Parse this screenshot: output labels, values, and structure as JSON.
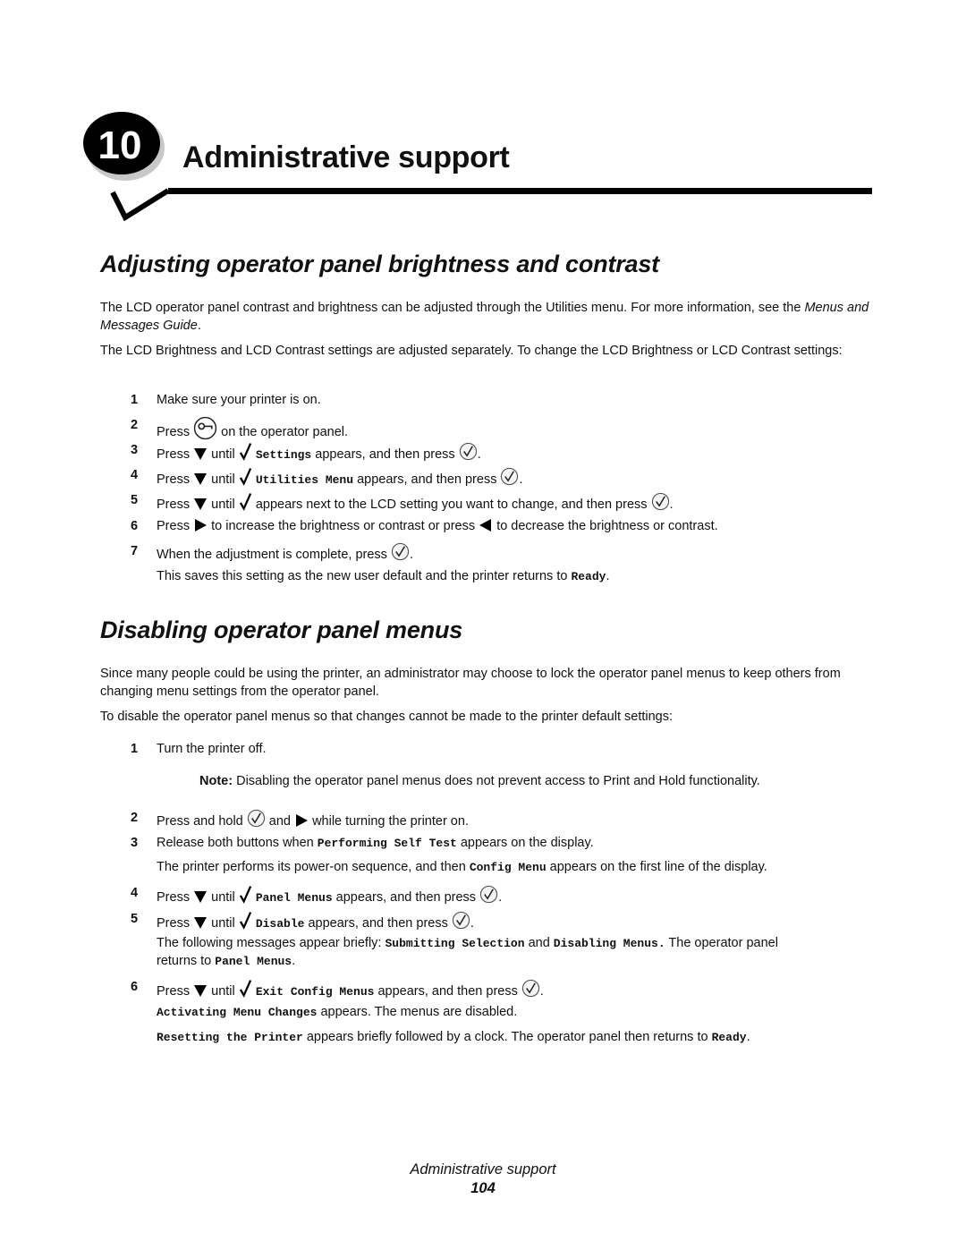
{
  "chapter": {
    "number": "10",
    "title": "Administrative support"
  },
  "section1": {
    "heading": "Adjusting operator panel brightness and contrast",
    "para1_a": "The LCD operator panel contrast and brightness can be adjusted through the Utilities menu. For more information, see the",
    "para1_b": "Menus and Messages Guide",
    "para1_c": ".",
    "para2": "The LCD Brightness and LCD Contrast settings are adjusted separately. To change the LCD Brightness or LCD Contrast settings:",
    "steps": [
      {
        "num": "1",
        "t1": "Make sure your printer is on."
      },
      {
        "num": "2",
        "t1": "Press",
        "t2": "on the operator panel."
      },
      {
        "num": "3",
        "t1": "Press",
        "t2": "until",
        "code": "Settings",
        "t3": "appears, and then press",
        "t4": "."
      },
      {
        "num": "4",
        "t1": "Press",
        "t2": "until",
        "code": "Utilities Menu",
        "t3": "appears, and then press",
        "t4": "."
      },
      {
        "num": "5",
        "t1": "Press",
        "t2": "until",
        "t3": "appears next to the LCD setting you want to change, and then press",
        "t4": "."
      },
      {
        "num": "6",
        "t1": "Press",
        "t2": "to increase the brightness or contrast or press",
        "t3": "to decrease the brightness or contrast."
      },
      {
        "num": "7",
        "t1": "When the adjustment is complete, press",
        "t2": "."
      }
    ],
    "after7_a": "This saves this setting as the new user default and the printer returns to",
    "after7_code": "Ready",
    "after7_b": "."
  },
  "section2": {
    "heading": "Disabling operator panel menus",
    "para1": "Since many people could be using the printer, an administrator may choose to lock the operator panel menus to keep others from changing menu settings from the operator panel.",
    "para2": "To disable the operator panel menus so that changes cannot be made to the printer default settings:",
    "steps": [
      {
        "num": "1",
        "t1": "Turn the printer off."
      },
      {
        "num": "2",
        "t1": "Press and hold",
        "t2": "and",
        "t3": "while turning the printer on."
      },
      {
        "num": "3",
        "t1": "Release both buttons when",
        "code": "Performing Self Test",
        "t2": "appears on the display."
      },
      {
        "num": "4",
        "t1": "Press",
        "t2": "until",
        "code": "Panel Menus",
        "t3": "appears, and then press",
        "t4": "."
      },
      {
        "num": "5",
        "t1": "Press",
        "t2": "until",
        "code": "Disable",
        "t3": "appears, and then press",
        "t4": "."
      },
      {
        "num": "6",
        "t1": "Press",
        "t2": "until",
        "code": "Exit Config Menus",
        "t3": "appears, and then press",
        "t4": "."
      }
    ],
    "note_label": "Note:",
    "note_text": "Disabling the operator panel menus does not prevent access to Print and Hold functionality.",
    "after3_a": "The printer performs its power-on sequence, and then",
    "after3_code": "Config Menu",
    "after3_b": "appears on the first line of the display.",
    "after5_a": "The following messages appear briefly:",
    "after5_code1": "Submitting Selection",
    "after5_b": "and",
    "after5_code2": "Disabling Menus.",
    "after5_c": "The operator panel",
    "after5_d": "returns to",
    "after5_code3": "Panel Menus",
    "after5_e": ".",
    "after6a_code": "Activating Menu Changes",
    "after6a_text": "appears. The menus are disabled.",
    "after6b_code": "Resetting the Printer",
    "after6b_text": "appears briefly followed by a clock. The operator panel then returns to",
    "after6b_code2": "Ready",
    "after6b_end": "."
  },
  "footer": {
    "title": "Administrative support",
    "page": "104"
  },
  "icons": {
    "menu": "menu-key-icon",
    "down": "down-arrow-icon",
    "check": "check-mark-icon",
    "select": "select-button-icon",
    "right": "right-arrow-icon",
    "left": "left-arrow-icon"
  }
}
